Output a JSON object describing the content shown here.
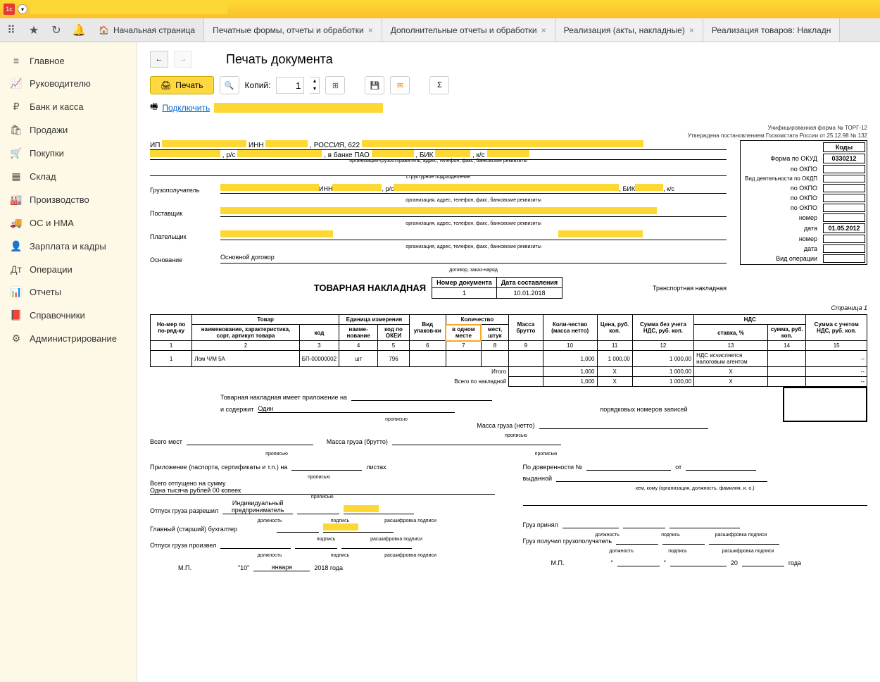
{
  "titlebar": {
    "logo": "1c"
  },
  "toolbar": {
    "tabs": [
      "Начальная страница",
      "Печатные формы, отчеты и обработки",
      "Дополнительные отчеты и обработки",
      "Реализация (акты, накладные)",
      "Реализация товаров: Накладн"
    ]
  },
  "sidebar": {
    "items": [
      {
        "icon": "≡",
        "label": "Главное"
      },
      {
        "icon": "📈",
        "label": "Руководителю"
      },
      {
        "icon": "₽",
        "label": "Банк и касса"
      },
      {
        "icon": "🛍",
        "label": "Продажи"
      },
      {
        "icon": "🛒",
        "label": "Покупки"
      },
      {
        "icon": "▦",
        "label": "Склад"
      },
      {
        "icon": "🏭",
        "label": "Производство"
      },
      {
        "icon": "🚚",
        "label": "ОС и НМА"
      },
      {
        "icon": "👤",
        "label": "Зарплата и кадры"
      },
      {
        "icon": "Дт",
        "label": "Операции"
      },
      {
        "icon": "📊",
        "label": "Отчеты"
      },
      {
        "icon": "📕",
        "label": "Справочники"
      },
      {
        "icon": "⚙",
        "label": "Администрирование"
      }
    ]
  },
  "page": {
    "title": "Печать документа",
    "print_btn": "Печать",
    "copies_label": "Копий:",
    "copies_value": "1",
    "connect_link": "Подключить"
  },
  "doc": {
    "form_note1": "Унифицированная форма № ТОРГ-12",
    "form_note2": "Утверждена постановлением Госкомстата России от 25.12.98 № 132",
    "codes_header": "Коды",
    "okud_label": "Форма по ОКУД",
    "okud_value": "0330212",
    "okpo_label": "по ОКПО",
    "okdp_label": "Вид деятельности по ОКДП",
    "ip_prefix": "ИП",
    "inn_text": "ИНН",
    "russia": ", РОССИЯ, 622",
    "bank_text": ", в банке ПАО",
    "bik_text": ", БИК",
    "rs_text": ", р/с",
    "ks_text": ", к/с",
    "org_caption": "организации-грузоотправитель, адрес, телефон, факс, банковские реквизиты",
    "struct_caption": "структурное подразделение",
    "consignee_label": "Грузополучатель",
    "org_caption2": "организация, адрес, телефон, факс, банковские реквизиты",
    "supplier_label": "Поставщик",
    "payer_label": "Плательщик",
    "basis_label": "Основание",
    "basis_value": "Основной договор",
    "basis_caption": "договор, заказ-наряд",
    "trans_label": "Транспортная накладная",
    "number_label": "номер",
    "date_label": "дата",
    "date_value": "01.05.2012",
    "op_type_label": "Вид операции",
    "torg_title": "ТОВАРНАЯ НАКЛАДНАЯ",
    "doc_num_header": "Номер документа",
    "doc_date_header": "Дата составления",
    "doc_num": "1",
    "doc_date": "10.01.2018",
    "page_label": "Страница 1"
  },
  "table": {
    "headers": {
      "num": "Но-мер по по-ряд-ку",
      "product": "Товар",
      "unit": "Единица измерения",
      "pack": "Вид упаков-ки",
      "qty": "Количество",
      "mass": "Масса брутто",
      "qty_net": "Коли-чество (масса нетто)",
      "price": "Цена, руб. коп.",
      "sum_no_vat": "Сумма без учета НДС, руб. коп.",
      "vat": "НДС",
      "sum_vat": "Сумма с учетом НДС, руб. коп.",
      "name": "наименование, характеристика, сорт, артикул товара",
      "code": "код",
      "unit_name": "наиме-нование",
      "okei": "код по ОКЕИ",
      "in_one": "в одном месте",
      "places": "мест, штук",
      "rate": "ставка, %",
      "vat_sum": "сумма, руб. коп."
    },
    "cols": [
      "1",
      "2",
      "3",
      "4",
      "5",
      "6",
      "7",
      "8",
      "9",
      "10",
      "11",
      "12",
      "13",
      "14",
      "15"
    ],
    "rows": [
      {
        "n": "1",
        "name": "Лом Ч/М 5А",
        "code": "БП-00000002",
        "unit": "шт",
        "okei": "796",
        "pack": "",
        "in_one": "",
        "places": "",
        "mass": "",
        "qty": "1,000",
        "price": "1 000,00",
        "sum": "1 000,00",
        "rate": "НДС исчисляется налоговым агентом",
        "vat_sum": "",
        "total": "--"
      }
    ],
    "itogo": "Итого",
    "vsego": "Всего по накладной",
    "itogo_vals": {
      "qty": "1,000",
      "price": "X",
      "sum": "1 000,00",
      "rate": "X",
      "vat": "",
      "tot": "--"
    },
    "vsego_vals": {
      "qty": "1,000",
      "price": "X",
      "sum": "1 000,00",
      "rate": "X",
      "vat": "",
      "tot": "--"
    }
  },
  "footer": {
    "appendix": "Товарная накладная имеет приложение на",
    "contains": "и содержит",
    "contains_val": "Один",
    "ord_label": "порядковых номеров записей",
    "propisyu": "прописью",
    "mass_net": "Масса груза (нетто)",
    "mass_gross": "Масса груза (брутто)",
    "total_places": "Всего мест",
    "attach": "Приложение (паспорта, сертификаты и т.п.) на",
    "sheets": "листах",
    "released_sum": "Всего отпущено  на сумму",
    "sum_words": "Одна тысяча рублей 00 копеек",
    "ind_pred": "Индивидуальный предприниматель",
    "release_auth": "Отпуск груза разрешил",
    "chief_acc": "Главный (старший) бухгалтер",
    "release_done": "Отпуск груза произвел",
    "position": "должность",
    "signature": "подпись",
    "decrypt": "расшифровка подписи",
    "mp": "М.П.",
    "date_day": "\"10\"",
    "date_month": "января",
    "date_year": "2018 года",
    "by_proxy": "По доверенности №",
    "from": "от",
    "issued": "выданной",
    "issued_caption": "кем, кому (организация, должность, фамилия, и. о.)",
    "cargo_accepted": "Груз принял",
    "cargo_received": "Груз получил грузополучатель",
    "year20": "20",
    "year_label": "года"
  }
}
